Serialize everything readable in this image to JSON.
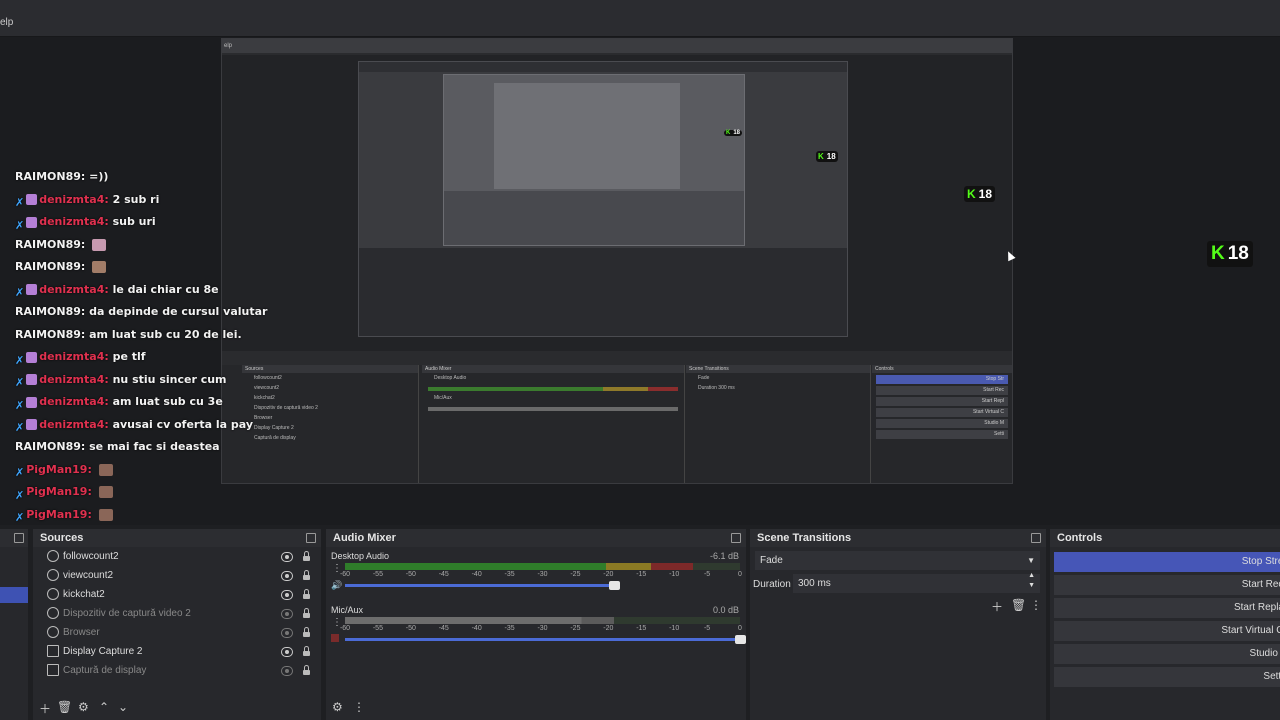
{
  "menubar": {
    "help_fragment": "elp"
  },
  "nested_capture": {
    "menu_fragment": "elp",
    "sources": [
      "followcount2",
      "viewcount2",
      "kickchat2",
      "Dispozitiv de captură video 2",
      "Browser",
      "Display Capture 2",
      "Captură de display"
    ],
    "audio_mixer_title": "Audio Mixer",
    "scene_transitions_title": "Scene Transitions",
    "controls_title": "Controls",
    "sources_title": "Sources",
    "desktop_audio": "Desktop Audio",
    "mic_aux": "Mic/Aux",
    "fade": "Fade",
    "duration": "Duration",
    "duration_value": "300 ms",
    "controls": [
      "Stop Str",
      "Start Rec",
      "Start Repl",
      "Start Virtual C",
      "Studio M",
      "Setti"
    ]
  },
  "chat": [
    {
      "user": "RAIMON89",
      "type": "white",
      "text": "=))",
      "badges": false,
      "emote": null
    },
    {
      "user": "denizmta4",
      "type": "red",
      "text": "2 sub ri",
      "badges": true,
      "emote": null
    },
    {
      "user": "denizmta4",
      "type": "red",
      "text": "sub uri",
      "badges": true,
      "emote": null
    },
    {
      "user": "RAIMON89",
      "type": "white",
      "text": "",
      "badges": false,
      "emote": "e1"
    },
    {
      "user": "RAIMON89",
      "type": "white",
      "text": "",
      "badges": false,
      "emote": "e2"
    },
    {
      "user": "denizmta4",
      "type": "red",
      "text": "le dai chiar cu 8e",
      "badges": true,
      "emote": null
    },
    {
      "user": "RAIMON89",
      "type": "white",
      "text": "da depinde de cursul valutar",
      "badges": false,
      "emote": null
    },
    {
      "user": "RAIMON89",
      "type": "white",
      "text": "am luat sub cu 20 de lei.",
      "badges": false,
      "emote": null
    },
    {
      "user": "denizmta4",
      "type": "red",
      "text": "pe tlf",
      "badges": true,
      "emote": null
    },
    {
      "user": "denizmta4",
      "type": "red",
      "text": "nu stiu sincer cum",
      "badges": true,
      "emote": null
    },
    {
      "user": "denizmta4",
      "type": "red",
      "text": "am luat sub cu 3e",
      "badges": true,
      "emote": null
    },
    {
      "user": "denizmta4",
      "type": "red",
      "text": "avusai cv oferta la pay",
      "badges": true,
      "emote": null
    },
    {
      "user": "RAIMON89",
      "type": "white",
      "text": "se mai fac si deastea",
      "badges": false,
      "emote": null
    },
    {
      "user": "PigMan19",
      "type": "pig",
      "text": "",
      "badges": false,
      "emote": "e3"
    },
    {
      "user": "PigMan19",
      "type": "pig",
      "text": "",
      "badges": false,
      "emote": "e3"
    },
    {
      "user": "PigMan19",
      "type": "pig",
      "text": "",
      "badges": false,
      "emote": "e3"
    }
  ],
  "kick_badge": {
    "label": "18"
  },
  "sources": {
    "title": "Sources",
    "items": [
      {
        "label": "followcount2",
        "visible": true,
        "icon": "browser-icon"
      },
      {
        "label": "viewcount2",
        "visible": true,
        "icon": "browser-icon"
      },
      {
        "label": "kickchat2",
        "visible": true,
        "icon": "browser-icon"
      },
      {
        "label": "Dispozitiv de captură video 2",
        "visible": false,
        "icon": "camera-icon"
      },
      {
        "label": "Browser",
        "visible": false,
        "icon": "browser-icon"
      },
      {
        "label": "Display Capture 2",
        "visible": true,
        "icon": "monitor-icon"
      },
      {
        "label": "Captură de display",
        "visible": false,
        "icon": "monitor-icon"
      }
    ]
  },
  "audio_mixer": {
    "title": "Audio Mixer",
    "ticks": [
      "-60",
      "-55",
      "-50",
      "-45",
      "-40",
      "-35",
      "-30",
      "-25",
      "-20",
      "-15",
      "-10",
      "-5",
      "0"
    ],
    "channels": [
      {
        "name": "Desktop Audio",
        "db": "-6.1 dB",
        "level": 0.88,
        "volume": 0.7
      },
      {
        "name": "Mic/Aux",
        "db": "0.0 dB",
        "level": 0.68,
        "volume": 1.0
      }
    ]
  },
  "scene_transitions": {
    "title": "Scene Transitions",
    "transition": "Fade",
    "duration_label": "Duration",
    "duration_value": "300 ms"
  },
  "controls": {
    "title": "Controls",
    "buttons": [
      "Stop Strea",
      "Start Reco",
      "Start Replay",
      "Start Virtual Ca",
      "Studio M",
      "Settin"
    ]
  },
  "colors": {
    "accent": "#4656b7",
    "kick_green": "#53fc18",
    "chat_red": "#e0314f"
  }
}
